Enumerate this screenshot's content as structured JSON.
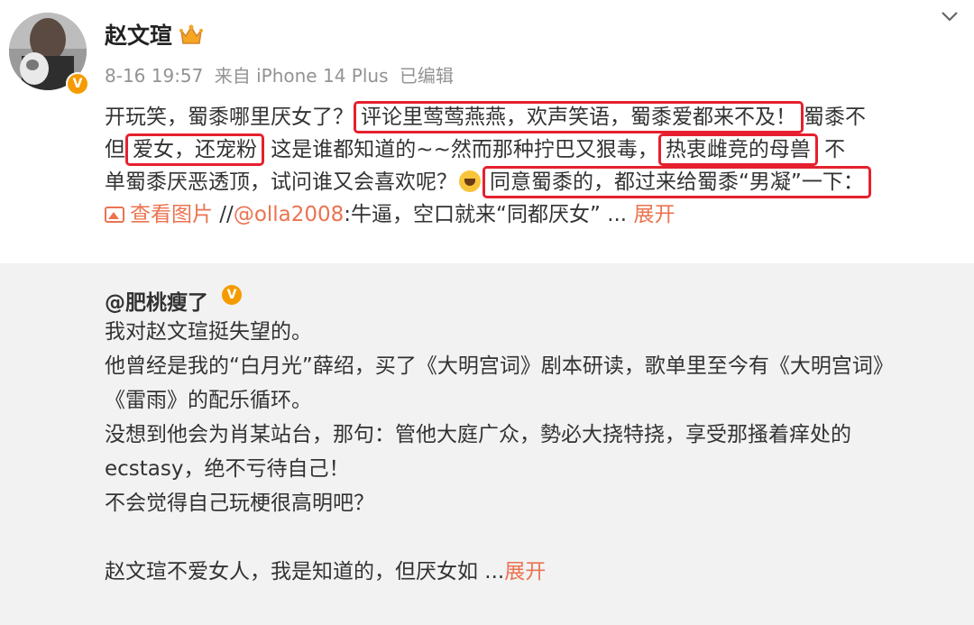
{
  "post": {
    "username": "赵文瑄",
    "meta": {
      "time": "8-16 19:57",
      "source": "来自 iPhone 14 Plus",
      "edited": "已编辑"
    },
    "lines": [
      [
        {
          "t": "开玩笑，蜀黍哪里厌女了？"
        },
        {
          "t": "评论里莺莺燕燕，欢声笑语，蜀黍爱都来不及！",
          "hl": true
        },
        {
          "t": "蜀黍不"
        }
      ],
      [
        {
          "t": "但"
        },
        {
          "t": "爱女，还宠粉",
          "hl": true
        },
        {
          "t": "  这是谁都知道的~~然而那种拧巴又狠毒，"
        },
        {
          "t": "热衷雌竞的母兽",
          "hl": true
        },
        {
          "t": "  不"
        }
      ],
      [
        {
          "t": "单蜀黍厌恶透顶，试问谁又会喜欢呢？"
        },
        {
          "emoji": "laugh-emoji"
        },
        {
          "t": "同意蜀黍的，都过来给蜀黍“男凝”一下：",
          "hl": true
        }
      ],
      [
        {
          "icon": "image-icon"
        },
        {
          "t": "查看图片",
          "link": true
        },
        {
          "t": " //"
        },
        {
          "t": "@olla2008",
          "link": true
        },
        {
          "t": ":牛逼，空口就来“同都厌女” ... "
        },
        {
          "t": "展开",
          "link": true
        }
      ]
    ]
  },
  "repost": {
    "author": "@肥桃瘦了",
    "lines": [
      "我对赵文瑄挺失望的。",
      "他曾经是我的“白月光”薛绍，买了《大明宫词》剧本研读，歌单里至今有《大明宫词》",
      "《雷雨》的配乐循环。",
      "没想到他会为肖某站台，那句：管他大庭广众，勢必大挠特挠，享受那搔着痒处的",
      "ecstasy，绝不亏待自己！",
      "不会觉得自己玩梗很高明吧？",
      "",
      "赵文瑄不爱女人，我是知道的，但厌女如  ..."
    ],
    "expand": "展开"
  },
  "colors": {
    "link": "#eb7350",
    "highlight": "#e6202e",
    "repost_bg": "#f2f2f2",
    "meta": "#939393"
  }
}
